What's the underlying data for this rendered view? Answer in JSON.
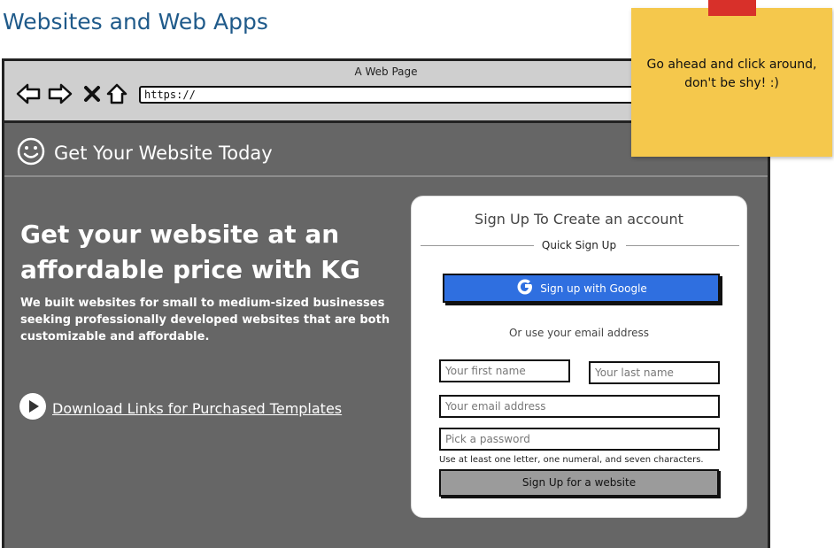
{
  "page": {
    "heading": "Websites and Web Apps"
  },
  "browser": {
    "window_title": "A Web Page",
    "url": "https://",
    "nav_icons": [
      "back-icon",
      "forward-icon",
      "close-icon",
      "home-icon"
    ]
  },
  "site": {
    "header_icon": "smiley-icon",
    "title": "Get Your Website Today"
  },
  "hero": {
    "title_line1": "Get your website at an",
    "title_line2": "affordable price with KG",
    "description": "We built websites for small to medium-sized businesses seeking professionally developed websites that are both customizable and affordable.",
    "download_icon": "play-icon",
    "download_link": "Download Links for Purchased Templates"
  },
  "signup": {
    "title": "Sign Up To Create an account",
    "quick_label": "Quick Sign Up",
    "google_label": "Sign up with Google",
    "google_icon": "google-g-icon",
    "or_text": "Or use your email address",
    "first_name_placeholder": "Your first name",
    "last_name_placeholder": "Your last name",
    "email_placeholder": "Your email address",
    "password_placeholder": "Pick a password",
    "password_hint": "Use at least one letter, one numeral, and seven characters.",
    "submit_label": "Sign Up for a website"
  },
  "sticky_note": {
    "text": "Go ahead and click around, don't be shy! :)"
  },
  "colors": {
    "heading": "#1f5a8a",
    "page_bg": "#666666",
    "google_button": "#2f6fe0",
    "submit_button": "#9b9b9b",
    "sticky_note": "#f5c84c",
    "sticky_tape": "#d8302a"
  }
}
